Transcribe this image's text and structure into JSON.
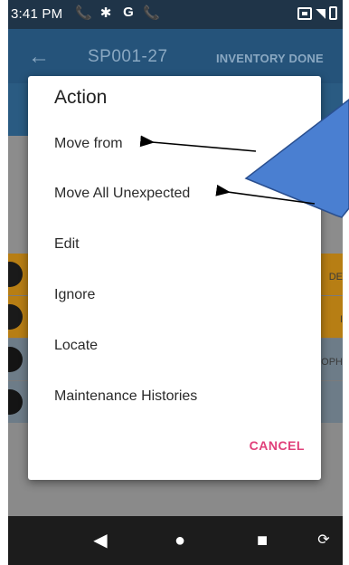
{
  "status_bar": {
    "time": "3:41 PM",
    "icons": [
      "phone-icon",
      "settings-icon",
      "google-icon",
      "phone-icon"
    ],
    "glyphs": {
      "phone": "📞",
      "settings": "✱",
      "google": "G"
    }
  },
  "app_bar": {
    "back_glyph": "←",
    "title": "SP001-27",
    "action": "INVENTORY DONE"
  },
  "background_rows": {
    "row1_text": "DE",
    "row2_text": "I",
    "row3_text": "OPH"
  },
  "dialog": {
    "title": "Action",
    "items": [
      {
        "label": "Move from"
      },
      {
        "label": "Move All Unexpected"
      },
      {
        "label": "Edit"
      },
      {
        "label": "Ignore"
      },
      {
        "label": "Locate"
      },
      {
        "label": "Maintenance Histories"
      }
    ],
    "cancel_label": "CANCEL"
  },
  "nav_bar": {
    "back_glyph": "◀",
    "home_glyph": "●",
    "recents_glyph": "■",
    "rotate_glyph": "⟳"
  },
  "colors": {
    "accent": "#e0407a",
    "app_bar": "#25537a",
    "status_bar": "#1f3448",
    "annotation": "#4a7fd1"
  }
}
